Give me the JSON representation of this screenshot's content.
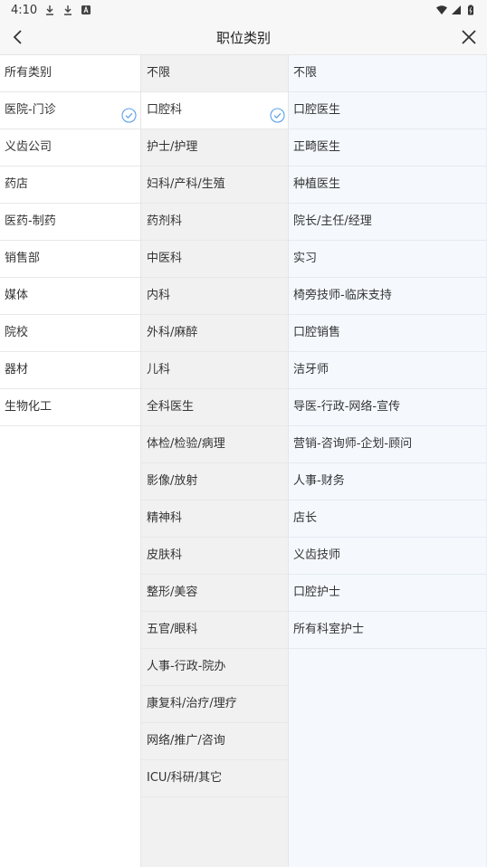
{
  "status_bar": {
    "time": "4:10"
  },
  "header": {
    "title": "职位类别"
  },
  "colors": {
    "accent": "#5aa0e8",
    "column2_bg": "#f1f1f1",
    "column3_bg": "#f5f9fe"
  },
  "column1": {
    "items": [
      "所有类别",
      "医院-门诊",
      "义齿公司",
      "药店",
      "医药-制药",
      "销售部",
      "媒体",
      "院校",
      "器材",
      "生物化工"
    ],
    "selected_index": 1
  },
  "column2": {
    "items": [
      "不限",
      "口腔科",
      "护士/护理",
      "妇科/产科/生殖",
      "药剂科",
      "中医科",
      "内科",
      "外科/麻醉",
      "儿科",
      "全科医生",
      "体检/检验/病理",
      "影像/放射",
      "精神科",
      "皮肤科",
      "整形/美容",
      "五官/眼科",
      "人事-行政-院办",
      "康复科/治疗/理疗",
      "网络/推广/咨询",
      "ICU/科研/其它"
    ],
    "selected_index": 1
  },
  "column3": {
    "items": [
      "不限",
      "口腔医生",
      "正畸医生",
      "种植医生",
      "院长/主任/经理",
      "实习",
      "椅旁技师-临床支持",
      "口腔销售",
      "洁牙师",
      "导医-行政-网络-宣传",
      "营销-咨询师-企划-顾问",
      "人事-财务",
      "店长",
      "义齿技师",
      "口腔护士",
      "所有科室护士"
    ]
  }
}
